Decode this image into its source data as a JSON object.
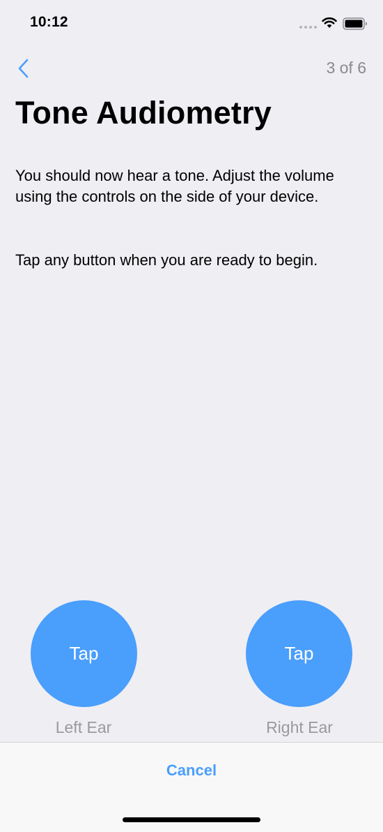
{
  "status_bar": {
    "time": "10:12",
    "icons": [
      "signal-dots-icon",
      "wifi-icon",
      "battery-icon"
    ]
  },
  "nav": {
    "back_icon": "chevron-left-icon",
    "step_counter": "3 of 6"
  },
  "title": "Tone Audiometry",
  "instructions": {
    "primary": "You should now hear a tone. Adjust the volume using the controls on the side of your device.",
    "secondary": "Tap any button when you are ready to begin."
  },
  "buttons": {
    "left": {
      "label": "Tap",
      "caption": "Left Ear"
    },
    "right": {
      "label": "Tap",
      "caption": "Right Ear"
    }
  },
  "footer": {
    "cancel_label": "Cancel"
  },
  "colors": {
    "accent": "#4a9efc",
    "background": "#efeef3",
    "secondary_text": "#8a8a8e"
  }
}
